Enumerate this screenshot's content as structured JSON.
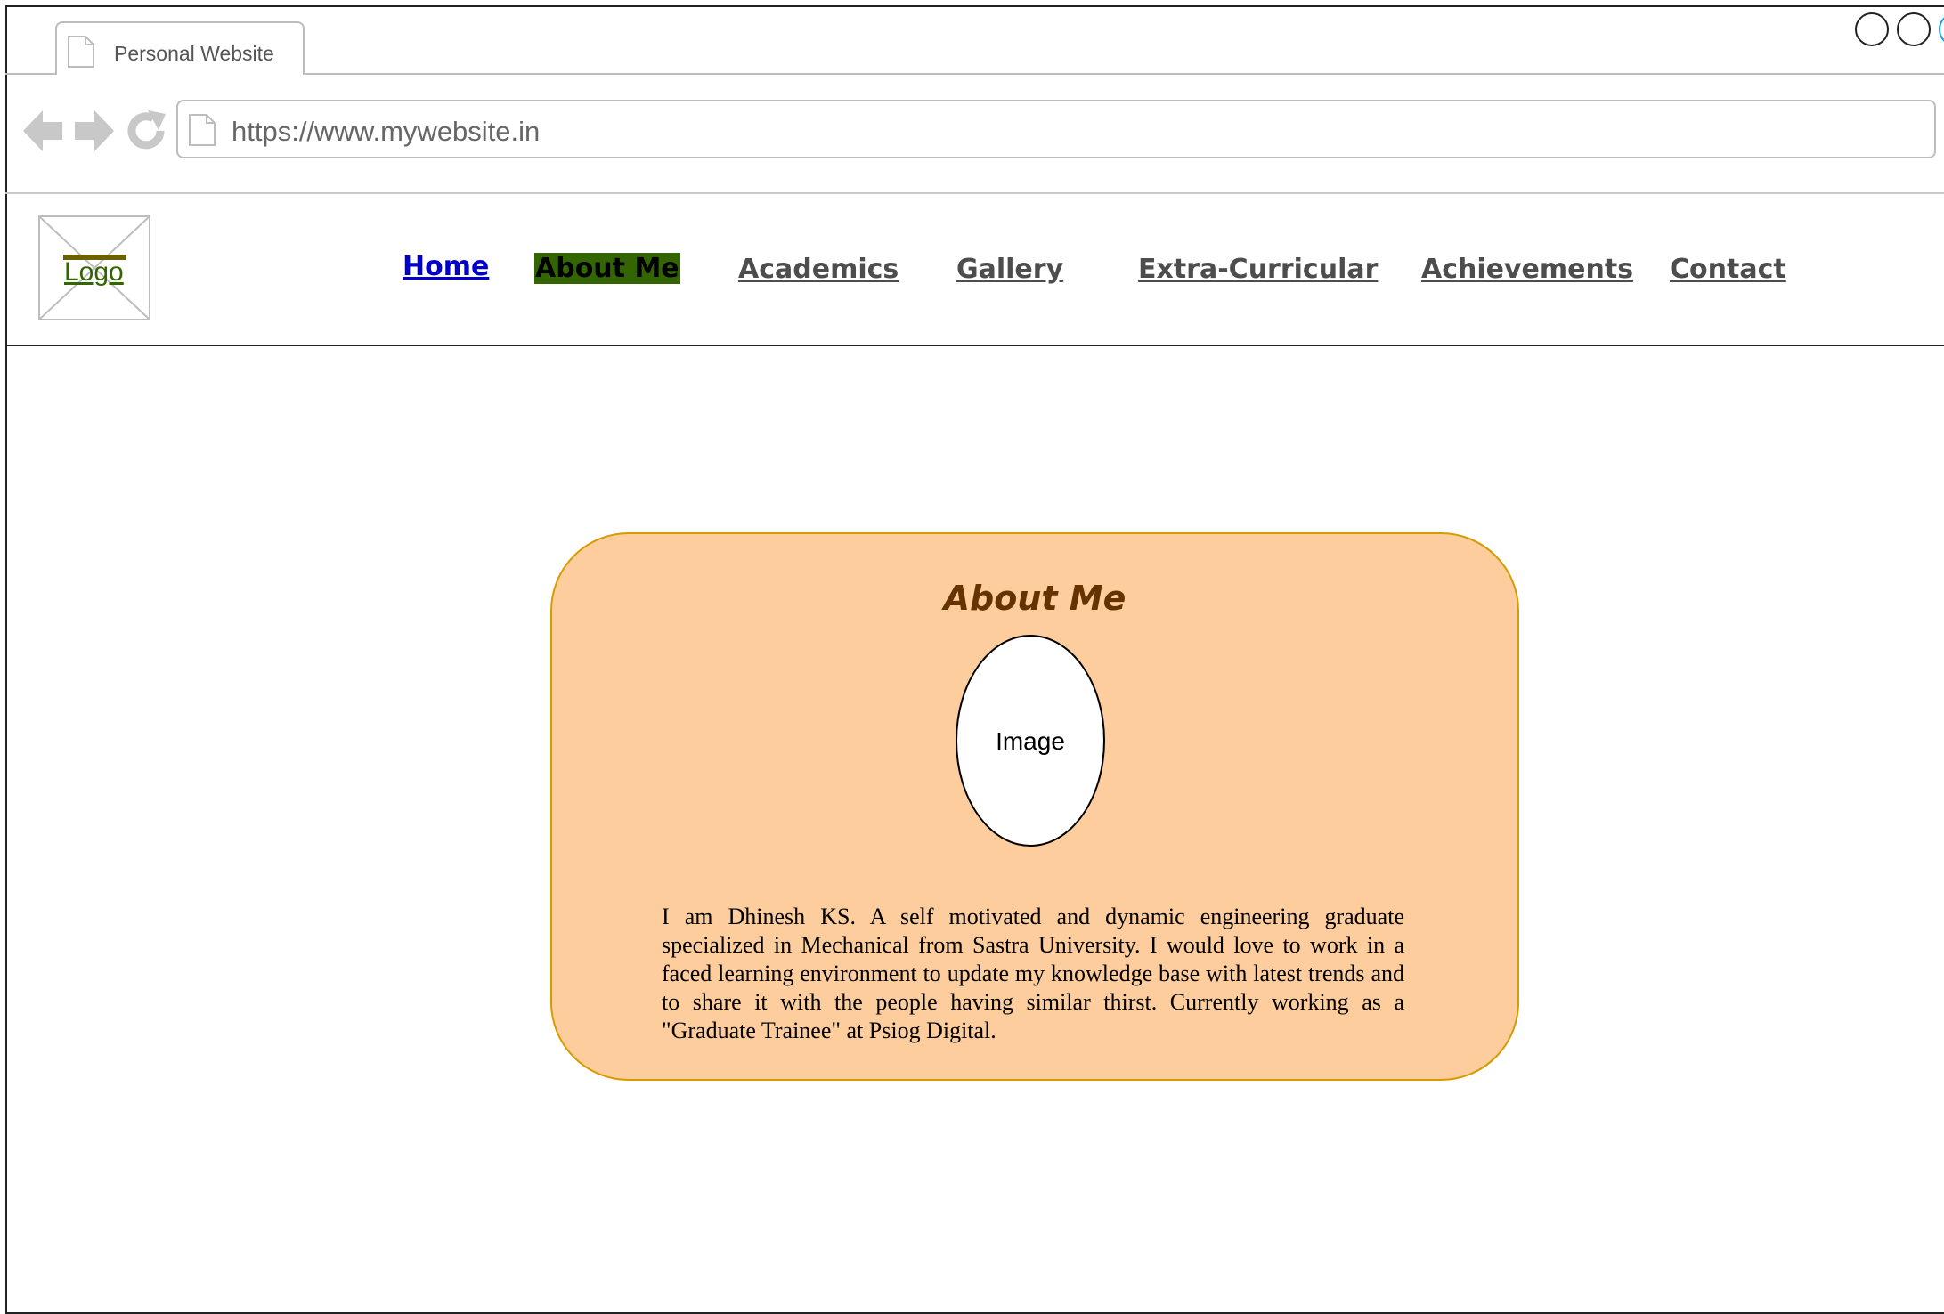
{
  "browser": {
    "tab_title": "Personal Website",
    "url": "https://www.mywebsite.in",
    "accent_color": "#1ba1e2"
  },
  "site": {
    "logo_label": "Logo",
    "nav": [
      {
        "label": "Home",
        "state": "link"
      },
      {
        "label": "About Me",
        "state": "active"
      },
      {
        "label": "Academics",
        "state": "default"
      },
      {
        "label": "Gallery",
        "state": "default"
      },
      {
        "label": "Extra-Curricular",
        "state": "default"
      },
      {
        "label": "Achievements",
        "state": "default"
      },
      {
        "label": "Contact",
        "state": "default"
      }
    ],
    "colors": {
      "link": "#0000cc",
      "active_bg": "#336600",
      "card_bg": "#fdcd9d",
      "card_border": "#d79b00",
      "title": "#663300"
    }
  },
  "about": {
    "title": "About Me",
    "image_label": "Image",
    "text": "I am Dhinesh KS. A self motivated and dynamic engineering graduate specialized in Mechanical from Sastra University. I would love to work in a faced learning environment to update my knowledge base with latest trends and to share it with the people having similar thirst.  Currently working as a \"Graduate Trainee\" at Psiog Digital."
  }
}
